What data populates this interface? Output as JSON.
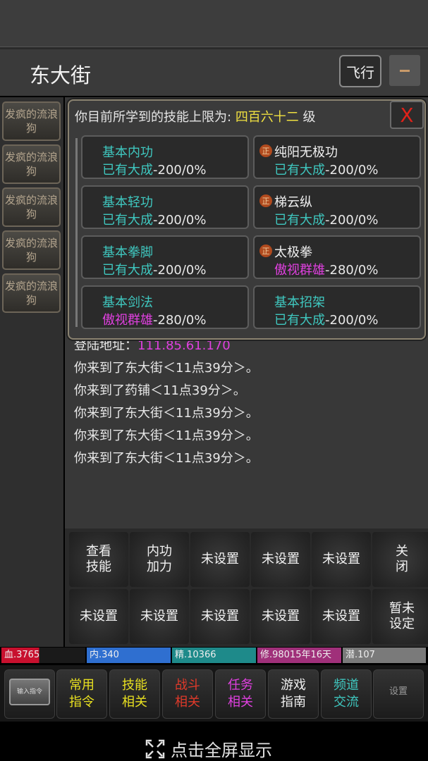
{
  "location": {
    "title": "东大街",
    "fly_label": "飞行"
  },
  "sidebar": {
    "npcs": [
      "发疯的流浪狗",
      "发疯的流浪狗",
      "发疯的流浪狗",
      "发疯的流浪狗",
      "发疯的流浪狗"
    ]
  },
  "log": {
    "partial_line_prefix": "登陆地址：",
    "partial_line_ip": "111.85.61.170",
    "lines": [
      "你来到了东大街＜11点39分＞。",
      "你来到了药铺＜11点39分＞。",
      "你来到了东大街＜11点39分＞。",
      "你来到了东大街＜11点39分＞。",
      "你来到了东大街＜11点39分＞。"
    ]
  },
  "skills_panel": {
    "header_prefix": "你目前所学到的技能上限为:",
    "header_level": "四百六十二",
    "header_suffix": "级",
    "close_label": "X",
    "enable_badge": "正",
    "skills": [
      {
        "name": "基本内功",
        "status": "已有大成",
        "progress": "-200/0%"
      },
      {
        "name": "纯阳无极功",
        "status": "已有大成",
        "progress": "-200/0%"
      },
      {
        "name": "基本轻功",
        "status": "已有大成",
        "progress": "-200/0%"
      },
      {
        "name": "梯云纵",
        "status": "已有大成",
        "progress": "-200/0%"
      },
      {
        "name": "基本拳脚",
        "status": "已有大成",
        "progress": "-200/0%"
      },
      {
        "name": "太极拳",
        "status": "傲视群雄",
        "progress": "-280/0%"
      },
      {
        "name": "基本剑法",
        "status": "傲视群雄",
        "progress": "-280/0%"
      },
      {
        "name": "基本招架",
        "status": "已有大成",
        "progress": "-200/0%"
      }
    ]
  },
  "commands": [
    "查看技能",
    "内功加力",
    "未设置",
    "未设置",
    "未设置",
    "关闭",
    "未设置",
    "未设置",
    "未设置",
    "未设置",
    "未设置",
    "暂未设定"
  ],
  "stats": [
    {
      "label": "血.3765",
      "color": "#c8102e",
      "fill": 0.45
    },
    {
      "label": "内.340",
      "color": "#2f6fd0",
      "fill": 1.0
    },
    {
      "label": "精.10366",
      "color": "#1e8a8a",
      "fill": 1.0
    },
    {
      "label": "修.98015年16天",
      "color": "#a0307a",
      "fill": 1.0
    },
    {
      "label": "潜.107",
      "color": "#7a7a7a",
      "fill": 1.0
    }
  ],
  "bottom_nav": {
    "input_label": "输入指令",
    "buttons": [
      {
        "label": "常用指令",
        "color": "#e8e020"
      },
      {
        "label": "技能相关",
        "color": "#e8e020"
      },
      {
        "label": "战斗相关",
        "color": "#e03a2a"
      },
      {
        "label": "任务相关",
        "color": "#e040e0"
      },
      {
        "label": "游戏指南",
        "color": "#f0f0f0"
      },
      {
        "label": "频道交流",
        "color": "#3fc8c0"
      }
    ],
    "settings_label": "设置"
  },
  "fullscreen": {
    "label": "点击全屏显示"
  }
}
